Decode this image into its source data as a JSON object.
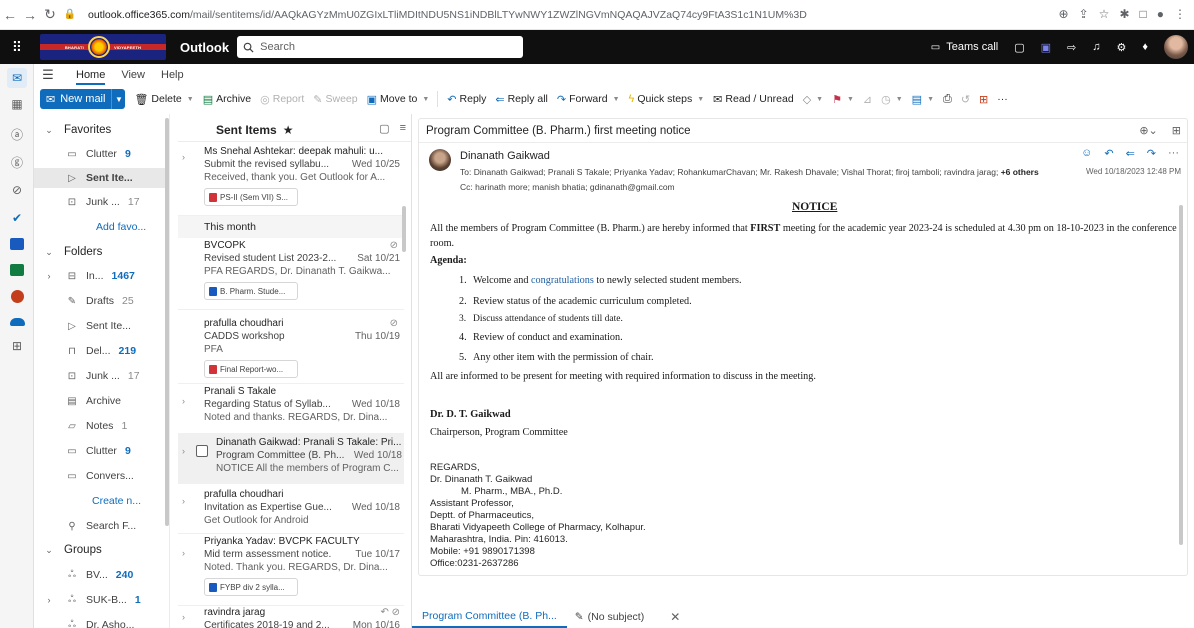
{
  "browser": {
    "url_host": "outlook.office365.com",
    "url_path": "/mail/sentitems/id/AAQkAGYzMmU0ZGIxLTliMDItNDU5NS1iNDBlLTYwNWY1ZWZlNGVmNQAQAJVZaQ74cy9FtA3S1c1N1UM%3D"
  },
  "suite": {
    "app_name": "Outlook",
    "search_placeholder": "Search",
    "logo_text_left": "BHARATI",
    "logo_text_right": "VIDYAPEETH",
    "teams_call": "Teams call"
  },
  "ribbon": {
    "tabs": [
      "Home",
      "View",
      "Help"
    ],
    "new_mail": "New mail",
    "delete": "Delete",
    "archive": "Archive",
    "report": "Report",
    "sweep": "Sweep",
    "move_to": "Move to",
    "reply": "Reply",
    "reply_all": "Reply all",
    "forward": "Forward",
    "quick_steps": "Quick steps",
    "read_unread": "Read / Unread",
    "more": "···"
  },
  "folders": {
    "favorites": "Favorites",
    "clutter": "Clutter",
    "clutter_count": "9",
    "sent_items": "Sent Ite...",
    "junk": "Junk ...",
    "junk_count": "17",
    "add_favorite": "Add favo...",
    "folders_header": "Folders",
    "inbox": "In...",
    "inbox_count": "1467",
    "drafts": "Drafts",
    "drafts_count": "25",
    "sent_items2": "Sent Ite...",
    "deleted": "Del...",
    "deleted_count": "219",
    "junk2": "Junk ...",
    "junk2_count": "17",
    "archive": "Archive",
    "notes": "Notes",
    "notes_count": "1",
    "clutter2": "Clutter",
    "clutter2_count": "9",
    "conversation": "Convers...",
    "create_new": "Create n...",
    "search_folders": "Search F...",
    "groups_header": "Groups",
    "group1": "BV...",
    "group1_count": "240",
    "group2": "SUK-B...",
    "group2_count": "1",
    "group3": "Dr. Asho..."
  },
  "list": {
    "title": "Sent Items",
    "month_header": "This month",
    "messages": [
      {
        "from": "Ms Snehal Ashtekar: deepak mahuli: u...",
        "subject": "Submit the revised syllabu...",
        "date": "Wed 10/25",
        "preview": "Received, thank you. Get Outlook for A...",
        "attachment": "PS-II (Sem VII) S..."
      },
      {
        "from": "BVCOPK",
        "subject": "Revised student List 2023-2...",
        "date": "Sat 10/21",
        "preview": "PFA REGARDS, Dr. Dinanath T. Gaikwa...",
        "attachment": "B. Pharm. Stude..."
      },
      {
        "from": "prafulla choudhari",
        "subject": "CADDS workshop",
        "date": "Thu 10/19",
        "preview": "PFA",
        "attachment": "Final Report-wo..."
      },
      {
        "from": "Pranali S Takale",
        "subject": "Regarding Status of Syllab...",
        "date": "Wed 10/18",
        "preview": "Noted and thanks. REGARDS, Dr. Dina..."
      },
      {
        "from": "Dinanath Gaikwad: Pranali S Takale: Pri...",
        "subject": "Program Committee (B. Ph...",
        "date": "Wed 10/18",
        "preview": "NOTICE All the members of Program C..."
      },
      {
        "from": "prafulla choudhari",
        "subject": "Invitation as Expertise Gue...",
        "date": "Wed 10/18",
        "preview": "Get Outlook for Android"
      },
      {
        "from": "Priyanka Yadav: BVCPK FACULTY",
        "subject": "Mid term assessment notice.",
        "date": "Tue 10/17",
        "preview": "Noted. Thank you. REGARDS, Dr. Dina...",
        "attachment": "FYBP div 2 sylla..."
      },
      {
        "from": "ravindra jarag",
        "subject": "Certificates 2018-19 and 2...",
        "date": "Mon 10/16"
      }
    ]
  },
  "reader": {
    "subject": "Program Committee (B. Pharm.) first meeting notice",
    "sender": "Dinanath Gaikwad",
    "to_label": "To:",
    "to": "Dinanath Gaikwad;  Pranali S Takale;  Priyanka Yadav;  RohankumarChavan;  Mr. Rakesh Dhavale;  Vishal Thorat;  firoj tamboli;  ravindra jarag;",
    "to_more": "+6 others",
    "cc_label": "Cc:",
    "cc": "harinath more;  manish bhatia;  gdinanath@gmail.com",
    "date": "Wed 10/18/2023 12:48 PM",
    "notice_title": "NOTICE",
    "para1_a": "All the members of Program Committee (B. Pharm.) are hereby informed that ",
    "para1_bold": "FIRST",
    "para1_b": " meeting for the academic year 2023-24 is scheduled at 4.30 pm on 18-10-2023 in the conference room.",
    "agenda_label": "Agenda:",
    "agenda": [
      {
        "n": "1.",
        "pre": "Welcome and ",
        "link": "congratulations",
        "post": " to newly selected student members."
      },
      {
        "n": "2.",
        "pre": "Review status of the academic curriculum completed.",
        "link": "",
        "post": ""
      },
      {
        "n": "3.",
        "pre": "Discuss attendance of students till date.",
        "link": "",
        "post": ""
      },
      {
        "n": "4.",
        "pre": "Review of conduct and examination.",
        "link": "",
        "post": ""
      },
      {
        "n": "5.",
        "pre": "Any other item with the permission of chair.",
        "link": "",
        "post": ""
      }
    ],
    "para2": "All are informed to be present for meeting with required information to discuss in the meeting.",
    "sig_name": "Dr. D. T. Gaikwad",
    "sig_role": "Chairperson, Program Committee",
    "regards": "REGARDS,",
    "sig_lines": [
      "Dr. Dinanath T. Gaikwad",
      "M. Pharm., MBA., Ph.D.",
      "Assistant Professor,",
      "Deptt. of Pharmaceutics,",
      "Bharati Vidyapeeth College of Pharmacy, Kolhapur.",
      "Maharashtra, India. Pin: 416013.",
      "Mobile: +91 9890171398",
      "Office:0231-2637286"
    ]
  },
  "bottom_tabs": {
    "tab1": "Program Committee (B. Ph...",
    "tab2": "(No subject)"
  },
  "colors": {
    "accent": "#0f6cbd",
    "suite_bar": "#0f0f0f"
  }
}
